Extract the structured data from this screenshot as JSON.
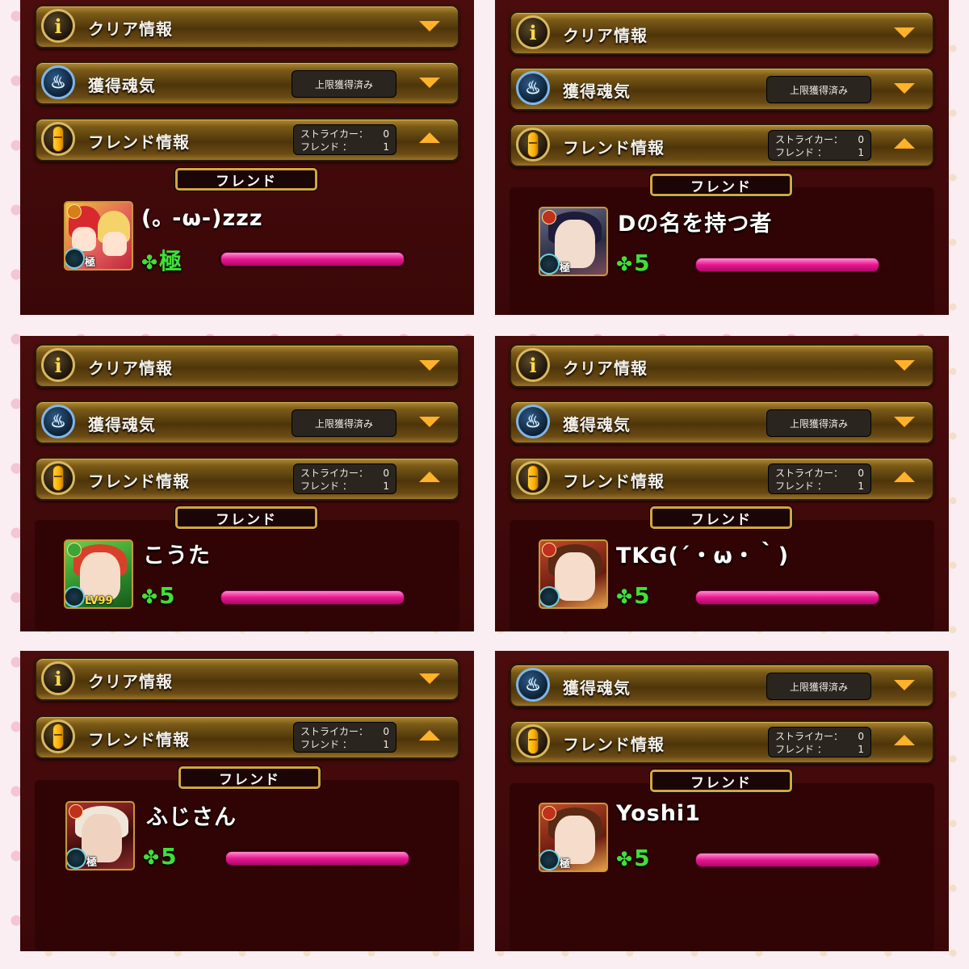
{
  "bars": {
    "clear_info": "クリア情報",
    "soul": "獲得魂気",
    "soul_status": "上限獲得済み",
    "friend_info": "フレンド情報",
    "striker_label": "ストライカー：",
    "striker_count": "0",
    "friend_label": "フレンド",
    "friend_count": "1",
    "colon": "："
  },
  "icons": {
    "clear": "info-icon",
    "clear_glyph": "i",
    "soul": "soul-flame-icon",
    "soul_glyph": "♨",
    "friend": "friend-pill-icon",
    "expand": "chevron-down-icon",
    "collapse": "chevron-up-icon",
    "luck": "clover-icon",
    "luck_glyph": "✤"
  },
  "friend_heading": "フレンド",
  "cards": [
    {
      "name": "(｡ -ω-)zzz",
      "luck": "極",
      "avatar_sub": "極"
    },
    {
      "name": "Dの名を持つ者",
      "luck": "5",
      "avatar_sub": "極"
    },
    {
      "name": "こうた",
      "luck": "5",
      "avatar_sub": "LV99"
    },
    {
      "name": "TKG(´・ω・｀)",
      "luck": "5",
      "avatar_sub": ""
    },
    {
      "name": "ふじさん",
      "luck": "5",
      "avatar_sub": "極"
    },
    {
      "name": "Yoshi1",
      "luck": "5",
      "avatar_sub": "極"
    }
  ],
  "colors": {
    "panel_bg": "#420a0b",
    "bar_gold": "#b28a32",
    "arrow_orange": "#ffb22a",
    "luck_green": "#3fe03a",
    "gauge_pink": "#e6168f"
  }
}
